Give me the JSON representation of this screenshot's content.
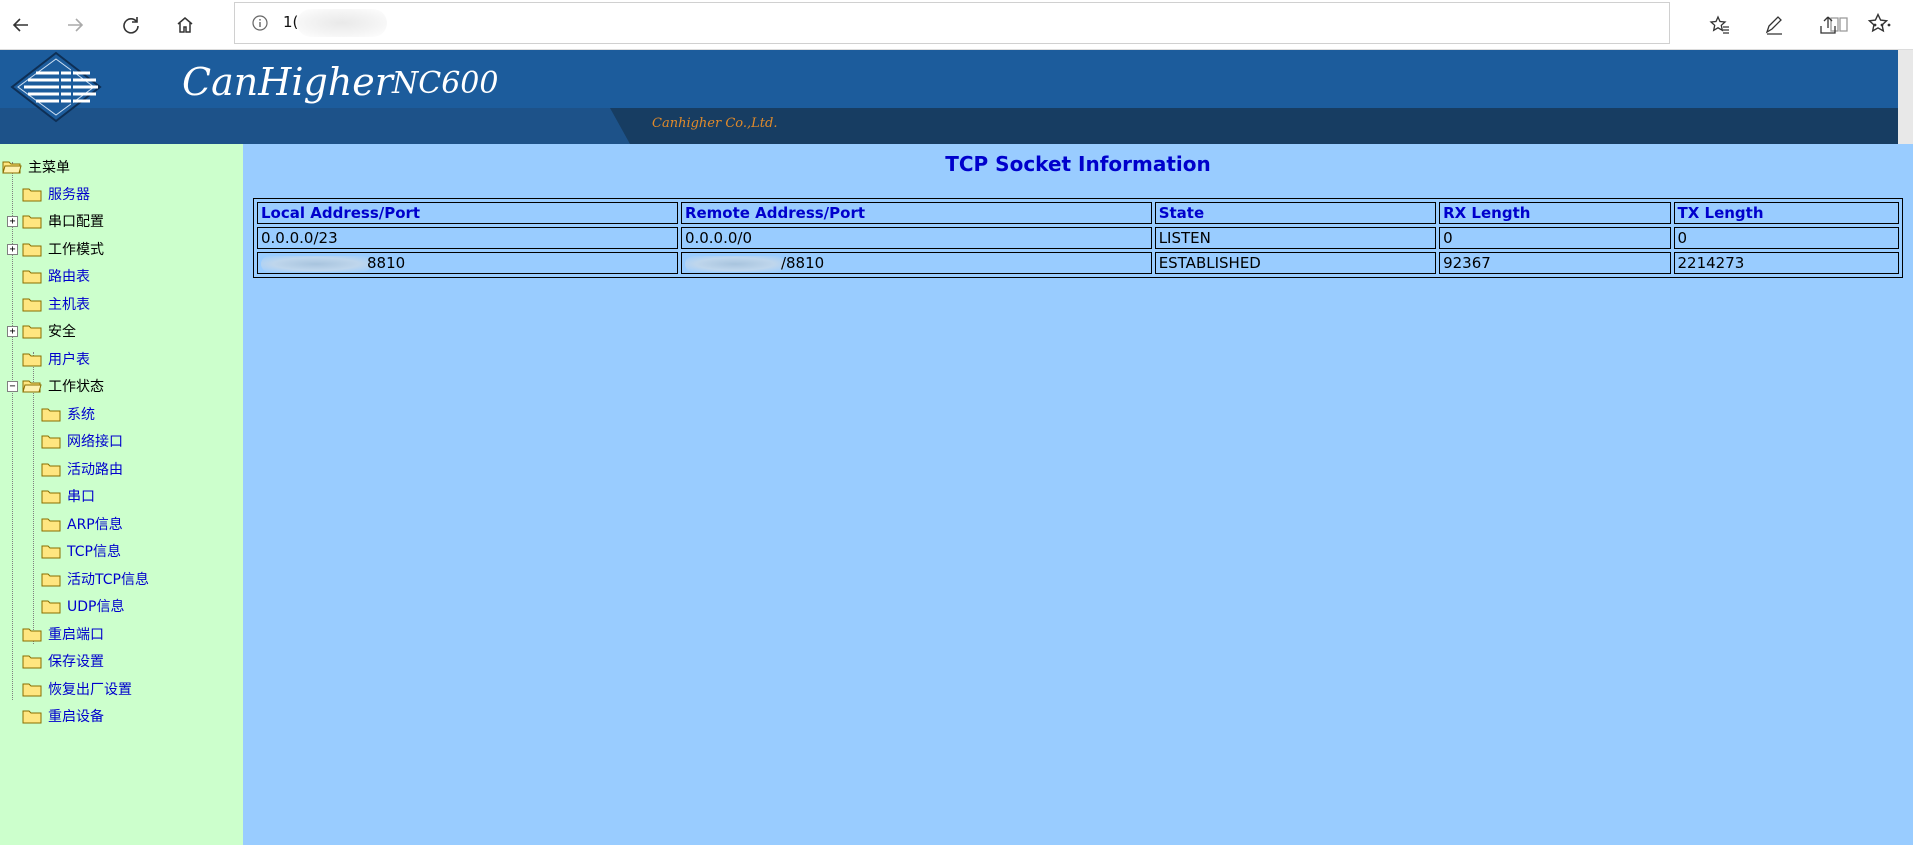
{
  "browser": {
    "address_text": "1(",
    "icons": [
      "back-icon",
      "forward-icon",
      "refresh-icon",
      "home-icon",
      "info-icon",
      "reading-view-icon",
      "favorite-star-icon",
      "favorites-icon",
      "pen-icon",
      "share-icon",
      "more-icon"
    ]
  },
  "header": {
    "brand": "CanHigher",
    "model": "NC600",
    "company": "Canhigher Co.,Ltd.",
    "colors": {
      "banner": "#1c5c9c",
      "strip": "#173d62",
      "company_text": "#e08a2a"
    }
  },
  "sidebar": {
    "root": "主菜单",
    "items": [
      {
        "label": "服务器"
      },
      {
        "label": "串口配置",
        "toggle": "+"
      },
      {
        "label": "工作模式",
        "toggle": "+"
      },
      {
        "label": "路由表"
      },
      {
        "label": "主机表"
      },
      {
        "label": "安全",
        "toggle": "+"
      },
      {
        "label": "用户表"
      },
      {
        "label": "工作状态",
        "toggle": "−"
      },
      {
        "label": "重启端口"
      },
      {
        "label": "保存设置"
      },
      {
        "label": "恢复出厂设置"
      },
      {
        "label": "重启设备"
      }
    ],
    "status_children": [
      "系统",
      "网络接口",
      "活动路由",
      "串口",
      "ARP信息",
      "TCP信息",
      "活动TCP信息",
      "UDP信息"
    ]
  },
  "main": {
    "title": "TCP Socket Information",
    "columns": [
      "Local Address/Port",
      "Remote Address/Port",
      "State",
      "RX Length",
      "TX Length"
    ],
    "rows": [
      [
        "0.0.0.0/23",
        "0.0.0.0/0",
        "LISTEN",
        "0",
        "0"
      ],
      [
        "8810",
        "/8810",
        "ESTABLISHED",
        "92367",
        "2214273"
      ]
    ]
  }
}
